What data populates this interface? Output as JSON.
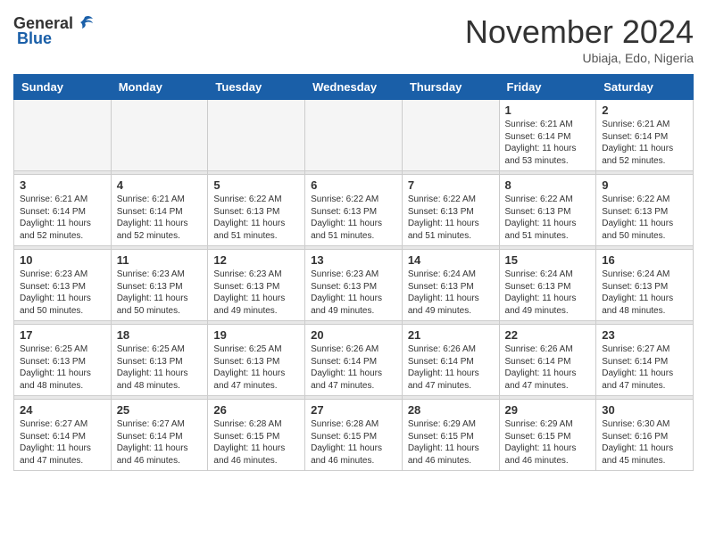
{
  "header": {
    "logo_general": "General",
    "logo_blue": "Blue",
    "month_title": "November 2024",
    "location": "Ubiaja, Edo, Nigeria"
  },
  "days_of_week": [
    "Sunday",
    "Monday",
    "Tuesday",
    "Wednesday",
    "Thursday",
    "Friday",
    "Saturday"
  ],
  "weeks": [
    {
      "days": [
        {
          "num": "",
          "empty": true
        },
        {
          "num": "",
          "empty": true
        },
        {
          "num": "",
          "empty": true
        },
        {
          "num": "",
          "empty": true
        },
        {
          "num": "",
          "empty": true
        },
        {
          "num": "1",
          "sunrise": "6:21 AM",
          "sunset": "6:14 PM",
          "daylight": "11 hours and 53 minutes."
        },
        {
          "num": "2",
          "sunrise": "6:21 AM",
          "sunset": "6:14 PM",
          "daylight": "11 hours and 52 minutes."
        }
      ]
    },
    {
      "days": [
        {
          "num": "3",
          "sunrise": "6:21 AM",
          "sunset": "6:14 PM",
          "daylight": "11 hours and 52 minutes."
        },
        {
          "num": "4",
          "sunrise": "6:21 AM",
          "sunset": "6:14 PM",
          "daylight": "11 hours and 52 minutes."
        },
        {
          "num": "5",
          "sunrise": "6:22 AM",
          "sunset": "6:13 PM",
          "daylight": "11 hours and 51 minutes."
        },
        {
          "num": "6",
          "sunrise": "6:22 AM",
          "sunset": "6:13 PM",
          "daylight": "11 hours and 51 minutes."
        },
        {
          "num": "7",
          "sunrise": "6:22 AM",
          "sunset": "6:13 PM",
          "daylight": "11 hours and 51 minutes."
        },
        {
          "num": "8",
          "sunrise": "6:22 AM",
          "sunset": "6:13 PM",
          "daylight": "11 hours and 51 minutes."
        },
        {
          "num": "9",
          "sunrise": "6:22 AM",
          "sunset": "6:13 PM",
          "daylight": "11 hours and 50 minutes."
        }
      ]
    },
    {
      "days": [
        {
          "num": "10",
          "sunrise": "6:23 AM",
          "sunset": "6:13 PM",
          "daylight": "11 hours and 50 minutes."
        },
        {
          "num": "11",
          "sunrise": "6:23 AM",
          "sunset": "6:13 PM",
          "daylight": "11 hours and 50 minutes."
        },
        {
          "num": "12",
          "sunrise": "6:23 AM",
          "sunset": "6:13 PM",
          "daylight": "11 hours and 49 minutes."
        },
        {
          "num": "13",
          "sunrise": "6:23 AM",
          "sunset": "6:13 PM",
          "daylight": "11 hours and 49 minutes."
        },
        {
          "num": "14",
          "sunrise": "6:24 AM",
          "sunset": "6:13 PM",
          "daylight": "11 hours and 49 minutes."
        },
        {
          "num": "15",
          "sunrise": "6:24 AM",
          "sunset": "6:13 PM",
          "daylight": "11 hours and 49 minutes."
        },
        {
          "num": "16",
          "sunrise": "6:24 AM",
          "sunset": "6:13 PM",
          "daylight": "11 hours and 48 minutes."
        }
      ]
    },
    {
      "days": [
        {
          "num": "17",
          "sunrise": "6:25 AM",
          "sunset": "6:13 PM",
          "daylight": "11 hours and 48 minutes."
        },
        {
          "num": "18",
          "sunrise": "6:25 AM",
          "sunset": "6:13 PM",
          "daylight": "11 hours and 48 minutes."
        },
        {
          "num": "19",
          "sunrise": "6:25 AM",
          "sunset": "6:13 PM",
          "daylight": "11 hours and 47 minutes."
        },
        {
          "num": "20",
          "sunrise": "6:26 AM",
          "sunset": "6:14 PM",
          "daylight": "11 hours and 47 minutes."
        },
        {
          "num": "21",
          "sunrise": "6:26 AM",
          "sunset": "6:14 PM",
          "daylight": "11 hours and 47 minutes."
        },
        {
          "num": "22",
          "sunrise": "6:26 AM",
          "sunset": "6:14 PM",
          "daylight": "11 hours and 47 minutes."
        },
        {
          "num": "23",
          "sunrise": "6:27 AM",
          "sunset": "6:14 PM",
          "daylight": "11 hours and 47 minutes."
        }
      ]
    },
    {
      "days": [
        {
          "num": "24",
          "sunrise": "6:27 AM",
          "sunset": "6:14 PM",
          "daylight": "11 hours and 47 minutes."
        },
        {
          "num": "25",
          "sunrise": "6:27 AM",
          "sunset": "6:14 PM",
          "daylight": "11 hours and 46 minutes."
        },
        {
          "num": "26",
          "sunrise": "6:28 AM",
          "sunset": "6:15 PM",
          "daylight": "11 hours and 46 minutes."
        },
        {
          "num": "27",
          "sunrise": "6:28 AM",
          "sunset": "6:15 PM",
          "daylight": "11 hours and 46 minutes."
        },
        {
          "num": "28",
          "sunrise": "6:29 AM",
          "sunset": "6:15 PM",
          "daylight": "11 hours and 46 minutes."
        },
        {
          "num": "29",
          "sunrise": "6:29 AM",
          "sunset": "6:15 PM",
          "daylight": "11 hours and 46 minutes."
        },
        {
          "num": "30",
          "sunrise": "6:30 AM",
          "sunset": "6:16 PM",
          "daylight": "11 hours and 45 minutes."
        }
      ]
    }
  ]
}
